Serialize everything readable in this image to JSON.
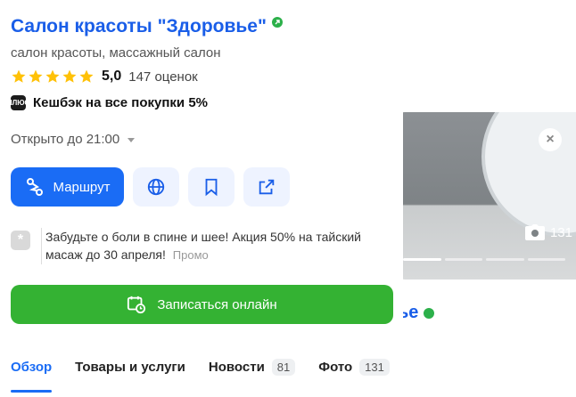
{
  "photos": {
    "count": "131",
    "behind_title": "ье"
  },
  "place": {
    "name": "Салон красоты \"Здоровье\"",
    "categories": "салон красоты, массажный салон",
    "rating": "5,0",
    "reviews": "147 оценок",
    "stars": 5,
    "cashback_badge": "ПЛЮС",
    "cashback": "Кешбэк на все покупки 5%",
    "hours": "Открыто до 21:00"
  },
  "actions": {
    "route_label": "Маршрут"
  },
  "promo": {
    "text": "Забудьте о боли в спине и шее! Акция 50% на тайский масаж до 30 апреля!",
    "label": "Промо"
  },
  "booking": {
    "label": "Записаться онлайн"
  },
  "tabs": [
    {
      "label": "Обзор",
      "count": ""
    },
    {
      "label": "Товары и услуги",
      "count": ""
    },
    {
      "label": "Новости",
      "count": "81"
    },
    {
      "label": "Фото",
      "count": "131"
    }
  ],
  "colors": {
    "accent": "#1a6cf5",
    "title": "#1a5ee8",
    "book": "#34b233",
    "star": "#ffc107"
  }
}
